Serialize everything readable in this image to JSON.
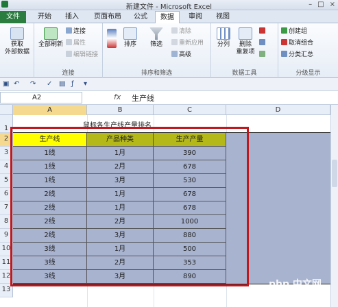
{
  "window": {
    "title": "新建文件 - Microsoft Excel",
    "controls": [
      "–",
      "□",
      "×"
    ]
  },
  "tabs": [
    "文件",
    "开始",
    "插入",
    "页面布局",
    "公式",
    "数据",
    "审阅",
    "视图"
  ],
  "active_tab": "数据",
  "ribbon": {
    "get_data": {
      "label1": "获取",
      "label2": "外部数据"
    },
    "refresh_all": "全部刷新",
    "connections": "连接",
    "properties": "属性",
    "edit_links": "编辑链接",
    "group_connections": "连接",
    "sort": "排序",
    "filter": "筛选",
    "clear": "清除",
    "reapply": "重新应用",
    "advanced": "高级",
    "group_sort_filter": "排序和筛选",
    "text_to_columns": "分列",
    "remove_dup1": "删除",
    "remove_dup2": "重复项",
    "group_data_tools": "数据工具",
    "create_group": "创建组",
    "ungroup": "取消组合",
    "subtotal": "分类汇总",
    "group_outline": "分级显示"
  },
  "formula_bar": {
    "name_box": "A2",
    "fx": "fx",
    "value": "生产线"
  },
  "columns": [
    "A",
    "B",
    "C",
    "D"
  ],
  "rows": [
    "1",
    "2",
    "3",
    "4",
    "5",
    "6",
    "7",
    "8",
    "9",
    "10",
    "11",
    "12",
    "13"
  ],
  "sheet": {
    "title": "鼠标各生产线产量排名",
    "headers": [
      "生产线",
      "产品种类",
      "生产产量"
    ],
    "data": [
      [
        "1线",
        "1月",
        "390"
      ],
      [
        "1线",
        "2月",
        "678"
      ],
      [
        "1线",
        "3月",
        "530"
      ],
      [
        "2线",
        "1月",
        "678"
      ],
      [
        "2线",
        "1月",
        "678"
      ],
      [
        "2线",
        "2月",
        "1000"
      ],
      [
        "2线",
        "3月",
        "880"
      ],
      [
        "3线",
        "1月",
        "500"
      ],
      [
        "3线",
        "2月",
        "353"
      ],
      [
        "3线",
        "3月",
        "890"
      ]
    ]
  },
  "watermark": "php 中文网",
  "colors": {
    "header_fill": "#b4b818",
    "selected_header": "#ffff00",
    "data_fill": "#a8b3cf",
    "highlight_box": "#c0171d",
    "file_tab": "#2a7d3f"
  }
}
